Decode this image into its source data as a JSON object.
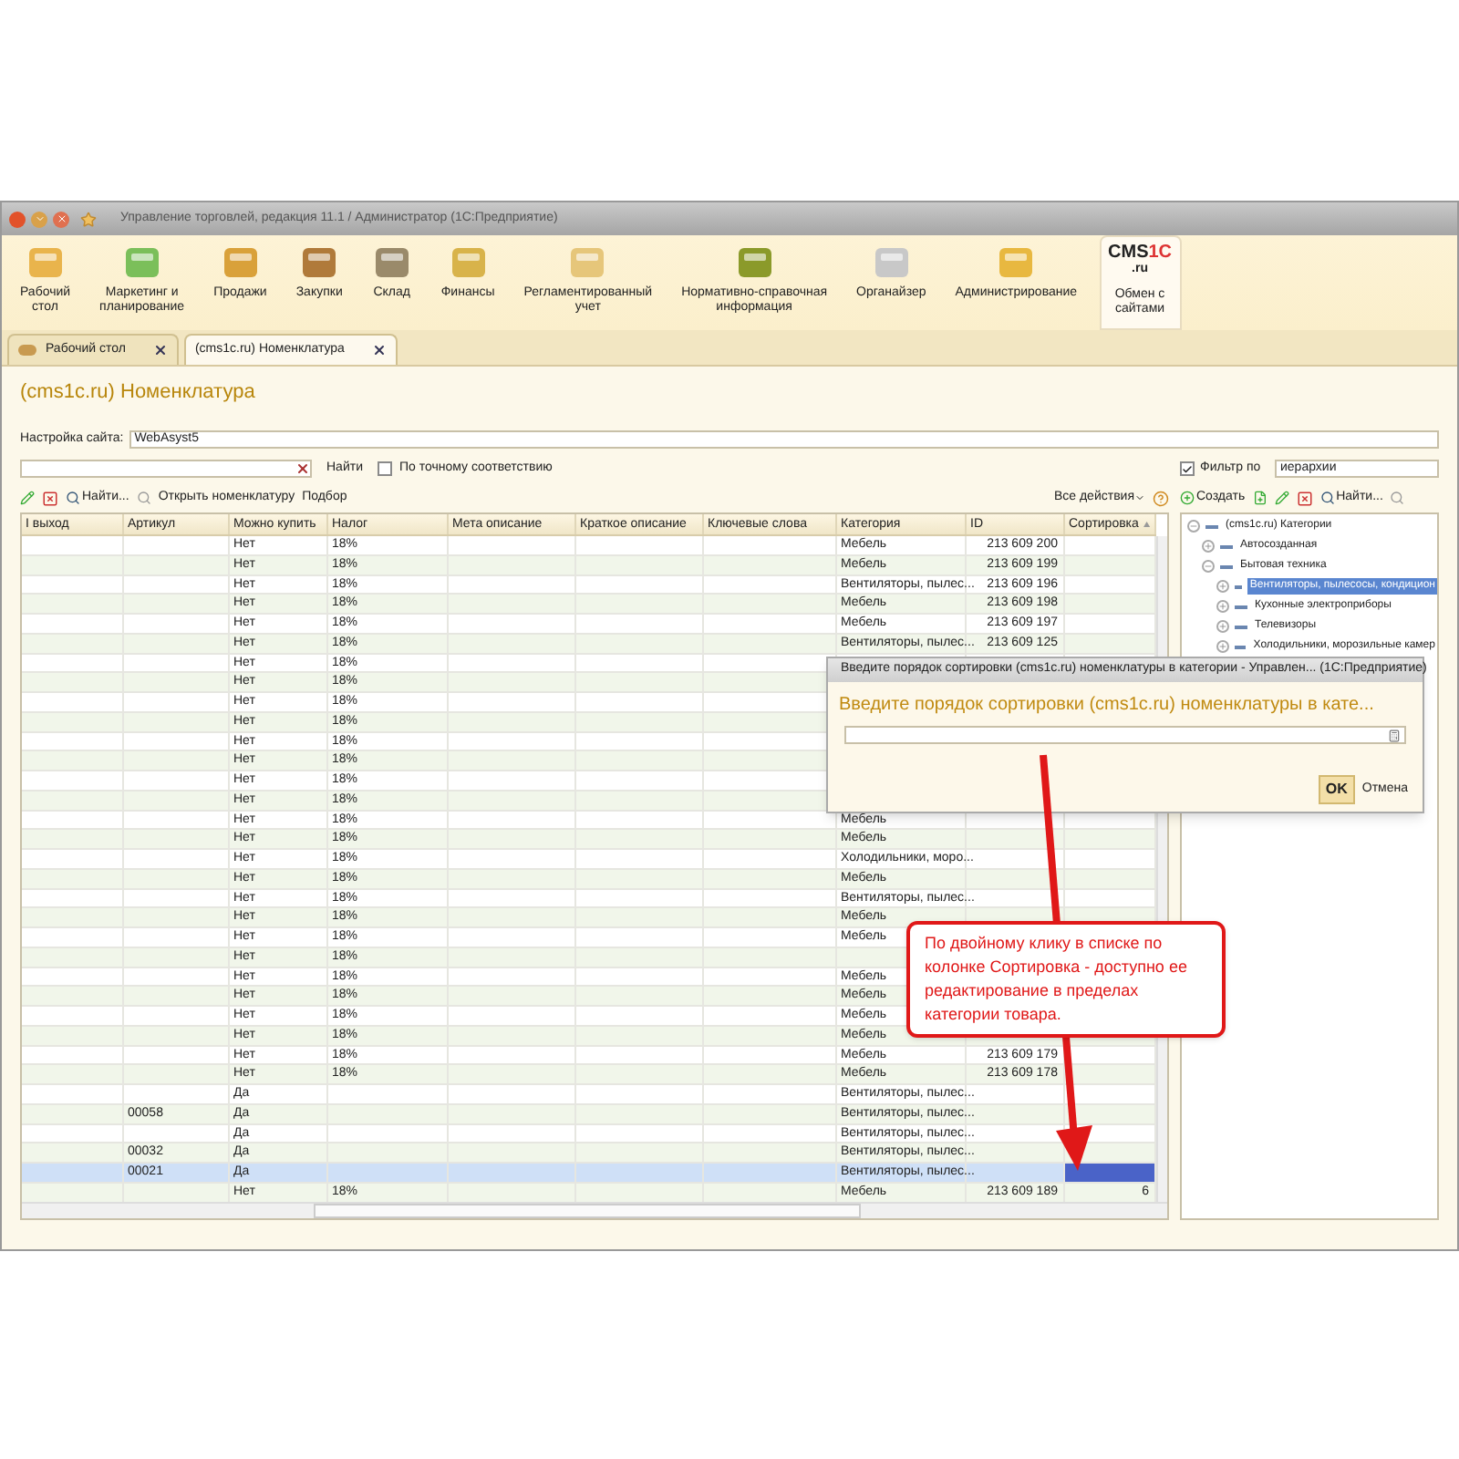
{
  "window": {
    "title": "Управление торговлей, редакция 11.1 / Администратор (1С:Предприятие)"
  },
  "sections": [
    {
      "label": "Рабочий\nстол",
      "selected": false
    },
    {
      "label": "Маркетинг и\nпланирование",
      "selected": false
    },
    {
      "label": "Продажи",
      "selected": false
    },
    {
      "label": "Закупки",
      "selected": false
    },
    {
      "label": "Склад",
      "selected": false
    },
    {
      "label": "Финансы",
      "selected": false
    },
    {
      "label": "Регламентированный\nучет",
      "selected": false
    },
    {
      "label": "Нормативно-справочная\nинформация",
      "selected": false
    },
    {
      "label": "Органайзер",
      "selected": false
    },
    {
      "label": "Администрирование",
      "selected": false
    },
    {
      "label": "Обмен с\nсайтами",
      "selected": true,
      "logo": {
        "main": "CMS",
        "accent": "1C",
        "sub": ".ru"
      }
    }
  ],
  "tabs": [
    {
      "label": "Рабочий стол",
      "selected": false
    },
    {
      "label": "(cms1c.ru) Номенклатура",
      "selected": true
    }
  ],
  "page": {
    "title": "(cms1c.ru) Номенклатура",
    "site_setting": {
      "label": "Настройка сайта:",
      "value": "WebAsyst5"
    },
    "search": {
      "button": "Найти",
      "exact": {
        "label": "По точному соответствию",
        "checked": false
      }
    },
    "toolbar": {
      "find": "Найти...",
      "open": "Открыть номенклатуру",
      "pick": "Подбор",
      "all_actions": "Все действия"
    },
    "table": {
      "columns": [
        "I выход",
        "Артикул",
        "Можно купить",
        "Налог",
        "Мета описание",
        "Краткое описание",
        "Ключевые слова",
        "Категория",
        "ID",
        "Сортировка"
      ],
      "rows": [
        {
          "can_buy": "Нет",
          "tax": "18%",
          "category": "Мебель",
          "id": "213 609 200",
          "selected": false
        },
        {
          "can_buy": "Нет",
          "tax": "18%",
          "category": "Мебель",
          "id": "213 609 199",
          "selected": false
        },
        {
          "can_buy": "Нет",
          "tax": "18%",
          "category": "Вентиляторы, пылес...",
          "id": "213 609 196",
          "selected": false
        },
        {
          "can_buy": "Нет",
          "tax": "18%",
          "category": "Мебель",
          "id": "213 609 198",
          "selected": false
        },
        {
          "can_buy": "Нет",
          "tax": "18%",
          "category": "Мебель",
          "id": "213 609 197",
          "selected": false
        },
        {
          "can_buy": "Нет",
          "tax": "18%",
          "category": "Вентиляторы, пылес...",
          "id": "213 609 125",
          "selected": false
        },
        {
          "can_buy": "Нет",
          "tax": "18%",
          "selected": false
        },
        {
          "can_buy": "Нет",
          "tax": "18%",
          "selected": false
        },
        {
          "can_buy": "Нет",
          "tax": "18%",
          "selected": false
        },
        {
          "can_buy": "Нет",
          "tax": "18%",
          "selected": false
        },
        {
          "can_buy": "Нет",
          "tax": "18%",
          "selected": false
        },
        {
          "can_buy": "Нет",
          "tax": "18%",
          "selected": false
        },
        {
          "can_buy": "Нет",
          "tax": "18%",
          "selected": false
        },
        {
          "can_buy": "Нет",
          "tax": "18%",
          "selected": false
        },
        {
          "can_buy": "Нет",
          "tax": "18%",
          "category": "Мебель",
          "selected": false
        },
        {
          "can_buy": "Нет",
          "tax": "18%",
          "category": "Мебель",
          "selected": false
        },
        {
          "can_buy": "Нет",
          "tax": "18%",
          "category": "Холодильники, моро...",
          "selected": false
        },
        {
          "can_buy": "Нет",
          "tax": "18%",
          "category": "Мебель",
          "selected": false
        },
        {
          "can_buy": "Нет",
          "tax": "18%",
          "category": "Вентиляторы, пылес...",
          "selected": false
        },
        {
          "can_buy": "Нет",
          "tax": "18%",
          "category": "Мебель",
          "selected": false
        },
        {
          "can_buy": "Нет",
          "tax": "18%",
          "category": "Мебель",
          "selected": false
        },
        {
          "can_buy": "Нет",
          "tax": "18%",
          "selected": false
        },
        {
          "can_buy": "Нет",
          "tax": "18%",
          "category": "Мебель",
          "selected": false
        },
        {
          "can_buy": "Нет",
          "tax": "18%",
          "category": "Мебель",
          "selected": false
        },
        {
          "can_buy": "Нет",
          "tax": "18%",
          "category": "Мебель",
          "selected": false
        },
        {
          "can_buy": "Нет",
          "tax": "18%",
          "category": "Мебель",
          "selected": false
        },
        {
          "can_buy": "Нет",
          "tax": "18%",
          "category": "Мебель",
          "id": "213 609 179",
          "selected": false
        },
        {
          "can_buy": "Нет",
          "tax": "18%",
          "category": "Мебель",
          "id": "213 609 178",
          "selected": false
        },
        {
          "can_buy": "Да",
          "category": "Вентиляторы, пылес...",
          "selected": false
        },
        {
          "article": "00058",
          "can_buy": "Да",
          "category": "Вентиляторы, пылес...",
          "selected": false
        },
        {
          "can_buy": "Да",
          "category": "Вентиляторы, пылес...",
          "selected": false
        },
        {
          "article": "00032",
          "can_buy": "Да",
          "category": "Вентиляторы, пылес...",
          "selected": false
        },
        {
          "article": "00021",
          "can_buy": "Да",
          "category": "Вентиляторы, пылес...",
          "selected": true
        },
        {
          "can_buy": "Нет",
          "tax": "18%",
          "category": "Мебель",
          "id": "213 609 189",
          "sort": "6",
          "selected": false
        }
      ]
    }
  },
  "side": {
    "filter": {
      "label": "Фильтр по",
      "checked": true,
      "value": "иерархии"
    },
    "toolbar": {
      "create": "Создать",
      "find": "Найти..."
    },
    "tree": [
      {
        "label": "(cms1c.ru) Категории",
        "expanded": true,
        "selected": false,
        "children": [
          {
            "label": "Автосозданная",
            "expanded": false,
            "selected": false
          },
          {
            "label": "Бытовая техника",
            "expanded": true,
            "selected": false,
            "children": [
              {
                "label": "Вентиляторы, пылесосы, кондицион",
                "expanded": false,
                "selected": true
              },
              {
                "label": "Кухонные электроприборы",
                "expanded": false,
                "selected": false
              },
              {
                "label": "Телевизоры",
                "expanded": false,
                "selected": false
              },
              {
                "label": "Холодильники, морозильные камер",
                "expanded": false,
                "selected": false
              }
            ]
          }
        ]
      }
    ]
  },
  "dialog": {
    "title": "Введите порядок сортировки (cms1c.ru) номенклатуры в категории - Управлен...  (1С:Предприятие)",
    "heading": "Введите порядок сортировки (cms1c.ru) номенклатуры в кате...",
    "ok": "OK",
    "cancel": "Отмена"
  },
  "callout": {
    "text": "По двойному клику в списке по колонке Сортировка - доступно ее редактирование в пределах категории товара."
  }
}
